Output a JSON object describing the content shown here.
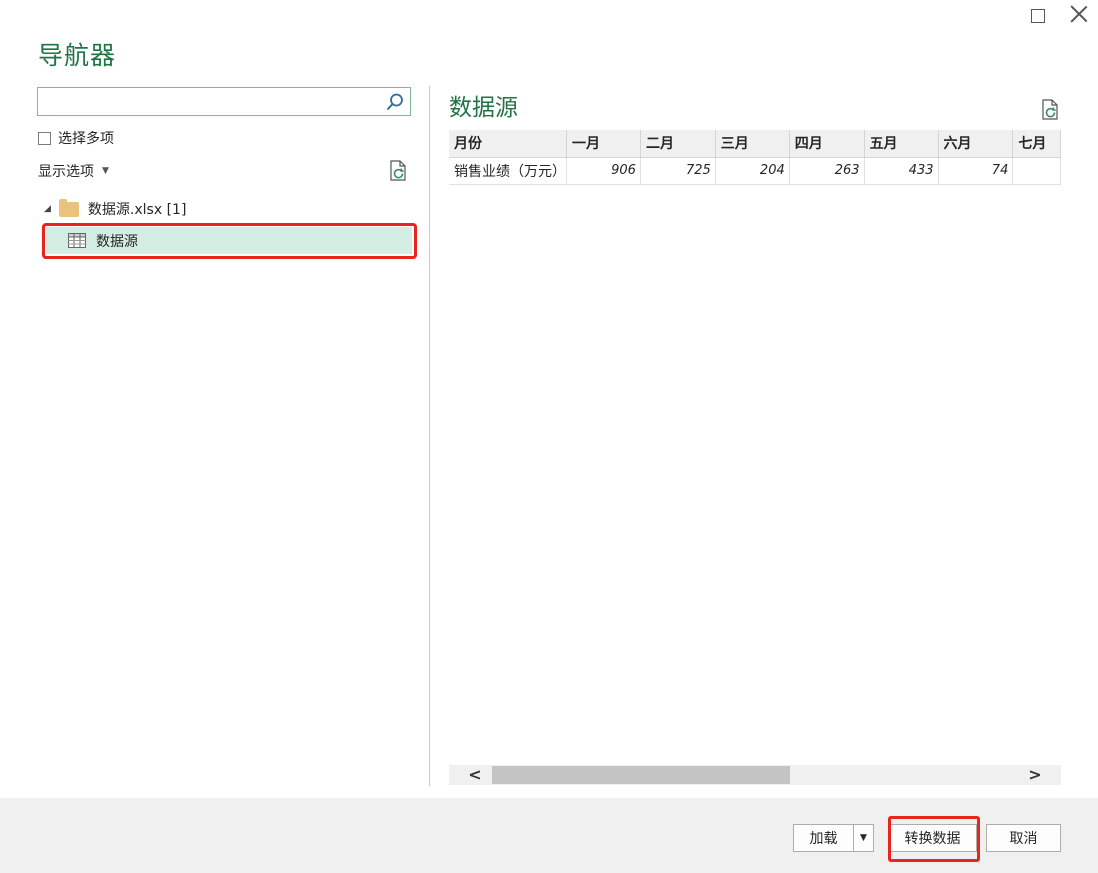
{
  "dialog": {
    "title": "导航器"
  },
  "left_pane": {
    "search_placeholder": "",
    "select_multiple_label": "选择多项",
    "display_options_label": "显示选项",
    "tree": {
      "file_label": "数据源.xlsx [1]",
      "items": [
        {
          "label": "数据源",
          "selected": true
        }
      ]
    }
  },
  "preview": {
    "title": "数据源",
    "columns": [
      "月份",
      "一月",
      "二月",
      "三月",
      "四月",
      "五月",
      "六月",
      "七月"
    ],
    "rows": [
      {
        "label": "销售业绩（万元）",
        "values": [
          "906",
          "725",
          "204",
          "263",
          "433",
          "74",
          ""
        ]
      }
    ]
  },
  "footer": {
    "load_label": "加载",
    "transform_label": "转换数据",
    "cancel_label": "取消"
  },
  "colors": {
    "accent": "#217346",
    "selection": "#d4ede2",
    "annotation": "#e8241c"
  },
  "icons": [
    "maximize-icon",
    "close-icon",
    "search-icon",
    "refresh-icon",
    "folder-icon",
    "table-icon",
    "dropdown-caret-icon",
    "scroll-left-icon",
    "scroll-right-icon"
  ]
}
